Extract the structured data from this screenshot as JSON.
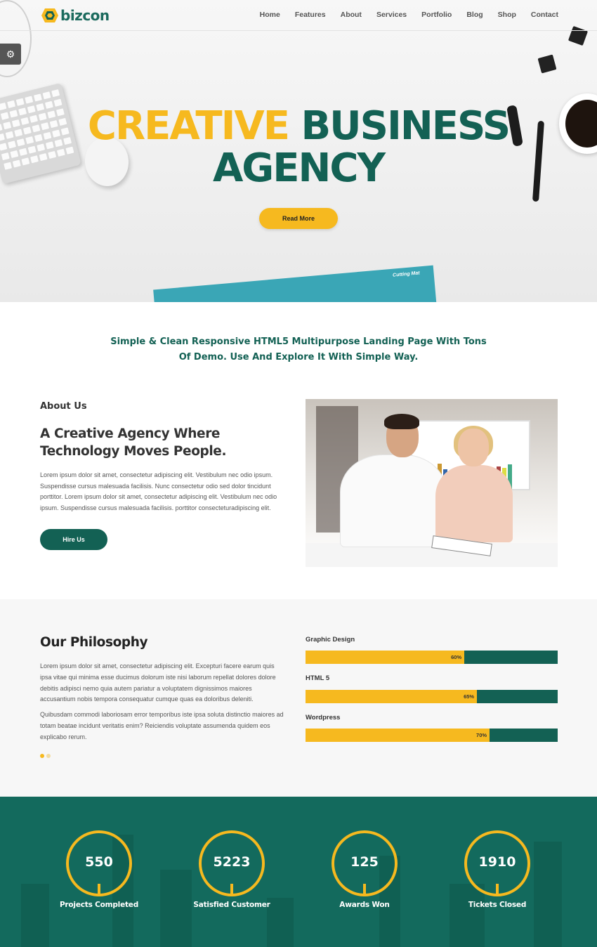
{
  "header": {
    "logo_text": "bizcon",
    "nav": [
      "Home",
      "Features",
      "About",
      "Services",
      "Portfolio",
      "Blog",
      "Shop",
      "Contact"
    ]
  },
  "hero": {
    "title_highlight": "CREATIVE",
    "title_rest": "BUSINESS",
    "title_line2": "AGENCY",
    "button": "Read More",
    "mat_label": "Cutting Mat"
  },
  "intro": {
    "line1": "Simple & Clean Responsive HTML5 Multipurpose Landing Page With Tons",
    "line2": "Of Demo. Use And Explore It With Simple Way."
  },
  "about": {
    "label": "About Us",
    "title": "A Creative Agency Where Technology Moves People.",
    "text": "Lorem ipsum dolor sit amet, consectetur adipiscing elit. Vestibulum nec odio ipsum. Suspendisse cursus malesuada facilisis. Nunc consectetur odio sed dolor tincidunt porttitor. Lorem ipsum dolor sit amet, consectetur adipiscing elit. Vestibulum nec odio ipsum. Suspendisse cursus malesuada facilisis. porttitor consecteturadipiscing elit.",
    "button": "Hire Us"
  },
  "philosophy": {
    "title": "Our Philosophy",
    "p1": "Lorem ipsum dolor sit amet, consectetur adipiscing elit. Excepturi facere earum quis ipsa vitae qui minima esse ducimus dolorum iste nisi laborum repellat dolores dolore debitis adipisci nemo quia autem pariatur a voluptatem dignissimos maiores accusantium nobis tempora consequatur cumque quas ea doloribus deleniti.",
    "p2": "Quibusdam commodi laboriosam error temporibus iste ipsa soluta distinctio maiores ad totam beatae incidunt veritatis enim? Reiciendis voluptate assumenda quidem eos explicabo rerum.",
    "skills": [
      {
        "name": "Graphic Design",
        "percent": 60,
        "label": "60%"
      },
      {
        "name": "HTML 5",
        "percent": 65,
        "label": "65%"
      },
      {
        "name": "Wordpress",
        "percent": 70,
        "label": "70%"
      }
    ]
  },
  "stats": [
    {
      "value": "550",
      "label": "Projects Completed"
    },
    {
      "value": "5223",
      "label": "Satisfied Customer"
    },
    {
      "value": "125",
      "label": "Awards Won"
    },
    {
      "value": "1910",
      "label": "Tickets Closed"
    }
  ],
  "colors": {
    "accent": "#f6b91f",
    "brand": "#136154"
  }
}
